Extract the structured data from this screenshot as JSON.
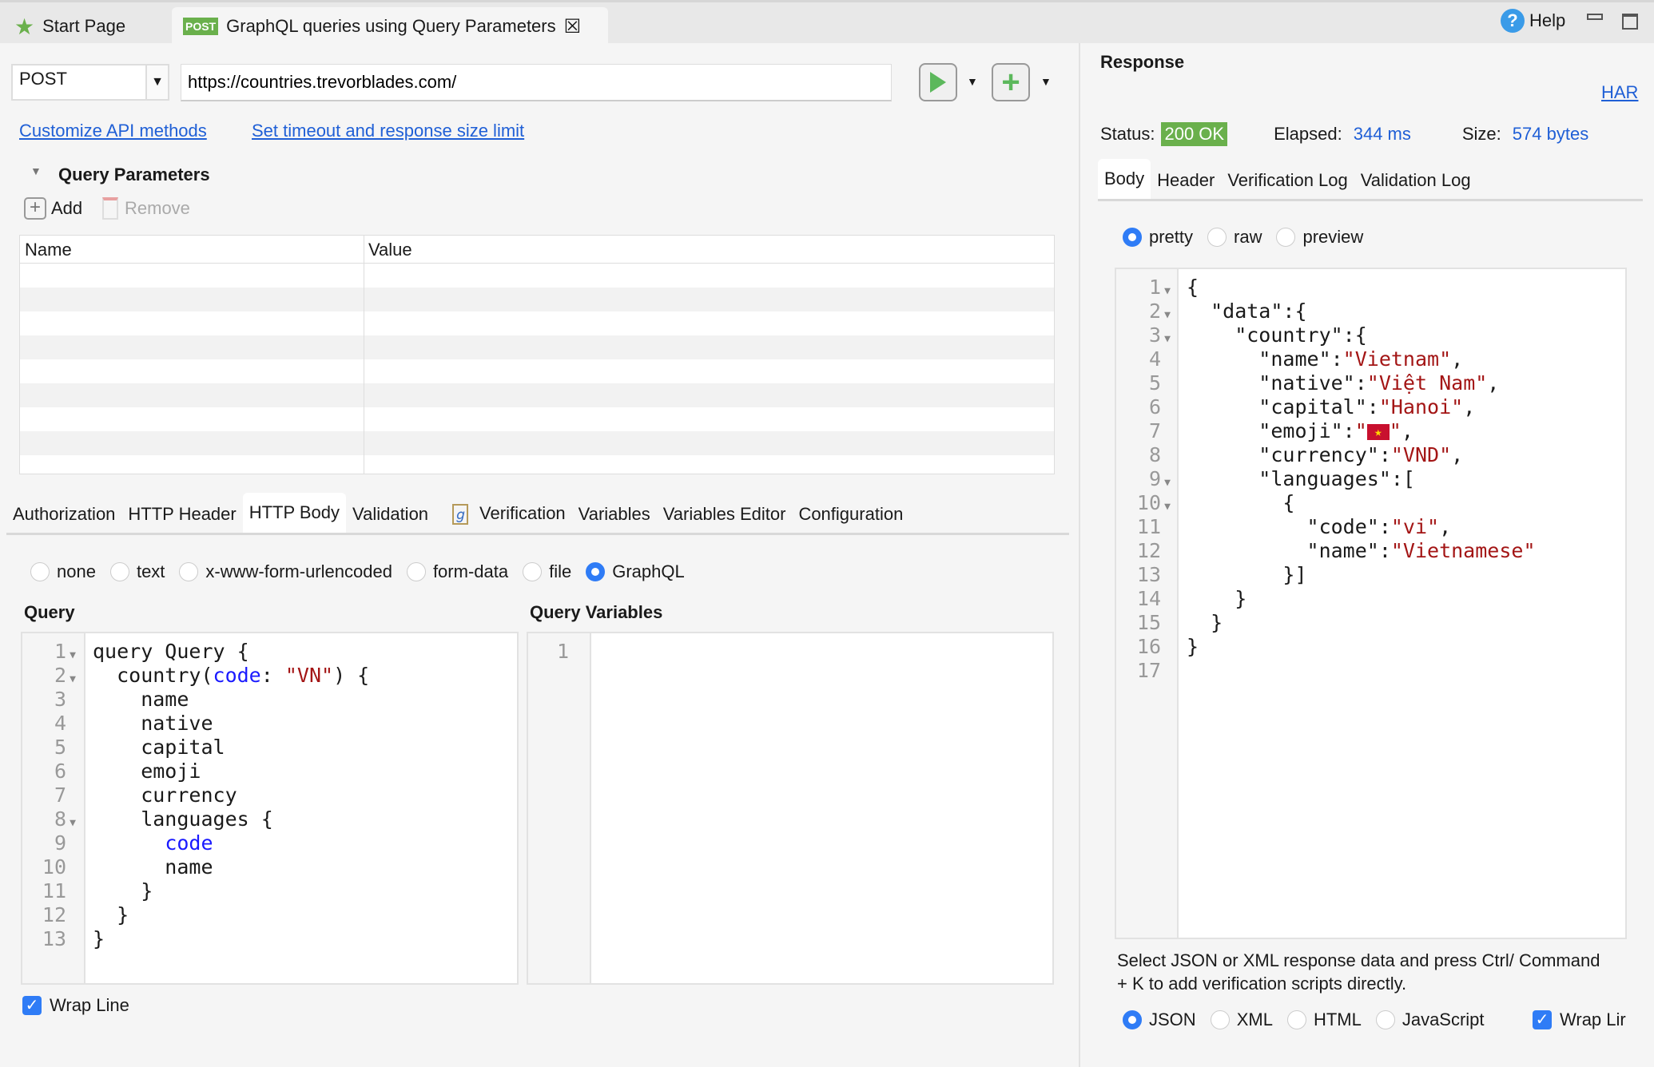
{
  "tabs": [
    {
      "label": "Start Page",
      "icon": "star-icon"
    },
    {
      "badge": "POST",
      "label": "GraphQL queries using Query Parameters",
      "icon": "close-icon"
    }
  ],
  "window": {
    "help": "Help"
  },
  "request": {
    "method": "POST",
    "url": "https://countries.trevorblades.com/",
    "links": {
      "customize": "Customize API methods",
      "timeout": "Set timeout and response size limit"
    }
  },
  "query_params": {
    "title": "Query Parameters",
    "add": "Add",
    "remove": "Remove",
    "columns": [
      "Name",
      "Value"
    ],
    "rows": []
  },
  "req_tabs": [
    "Authorization",
    "HTTP Header",
    "HTTP Body",
    "Validation",
    "Verification",
    "Variables",
    "Variables Editor",
    "Configuration"
  ],
  "req_active_tab": "HTTP Body",
  "body_types": [
    "none",
    "text",
    "x-www-form-urlencoded",
    "form-data",
    "file",
    "GraphQL"
  ],
  "body_selected": "GraphQL",
  "query": {
    "label": "Query",
    "fold_lines": [
      1,
      2,
      8
    ],
    "lines": [
      [
        [
          "query Query {",
          ""
        ]
      ],
      [
        [
          "  country(",
          ""
        ],
        [
          "code",
          "kw"
        ],
        [
          ": ",
          ""
        ],
        [
          "\"VN\"",
          "str"
        ],
        [
          ") {",
          ""
        ]
      ],
      [
        [
          "    name",
          ""
        ]
      ],
      [
        [
          "    native",
          ""
        ]
      ],
      [
        [
          "    capital",
          ""
        ]
      ],
      [
        [
          "    emoji",
          ""
        ]
      ],
      [
        [
          "    currency",
          ""
        ]
      ],
      [
        [
          "    languages {",
          ""
        ]
      ],
      [
        [
          "      ",
          ""
        ],
        [
          "code",
          "kw"
        ]
      ],
      [
        [
          "      name",
          ""
        ]
      ],
      [
        [
          "    }",
          ""
        ]
      ],
      [
        [
          "  }",
          ""
        ]
      ],
      [
        [
          "}",
          ""
        ]
      ]
    ]
  },
  "variables": {
    "label": "Query Variables",
    "lines": [
      [
        [
          "",
          ""
        ]
      ]
    ]
  },
  "wrap_line": {
    "label": "Wrap Line",
    "checked": true
  },
  "response": {
    "title": "Response",
    "har": "HAR",
    "status_label": "Status:",
    "status": "200 OK",
    "status_color": "#6ab04c",
    "elapsed_label": "Elapsed:",
    "elapsed": "344 ms",
    "size_label": "Size:",
    "size": "574 bytes",
    "tabs": [
      "Body",
      "Header",
      "Verification Log",
      "Validation Log"
    ],
    "active_tab": "Body",
    "formats": [
      "pretty",
      "raw",
      "preview"
    ],
    "format_selected": "pretty",
    "fold_lines": [
      1,
      2,
      3,
      9,
      10
    ],
    "lines": [
      [
        [
          "{",
          ""
        ]
      ],
      [
        [
          "  \"data\":{",
          ""
        ]
      ],
      [
        [
          "    \"country\":{",
          ""
        ]
      ],
      [
        [
          "      \"name\":",
          ""
        ],
        [
          "\"Vietnam\"",
          "str"
        ],
        [
          ",",
          ""
        ]
      ],
      [
        [
          "      \"native\":",
          ""
        ],
        [
          "\"Việt Nam\"",
          "str"
        ],
        [
          ",",
          ""
        ]
      ],
      [
        [
          "      \"capital\":",
          ""
        ],
        [
          "\"Hanoi\"",
          "str"
        ],
        [
          ",",
          ""
        ]
      ],
      [
        [
          "      \"emoji\":",
          ""
        ],
        [
          "\"",
          "str"
        ],
        [
          "🇻🇳",
          "flag"
        ],
        [
          "\"",
          "str"
        ],
        [
          ",",
          ""
        ]
      ],
      [
        [
          "      \"currency\":",
          ""
        ],
        [
          "\"VND\"",
          "str"
        ],
        [
          ",",
          ""
        ]
      ],
      [
        [
          "      \"languages\":[",
          ""
        ]
      ],
      [
        [
          "        {",
          ""
        ]
      ],
      [
        [
          "          \"code\":",
          ""
        ],
        [
          "\"vi\"",
          "str"
        ],
        [
          ",",
          ""
        ]
      ],
      [
        [
          "          \"name\":",
          ""
        ],
        [
          "\"Vietnamese\"",
          "str"
        ]
      ],
      [
        [
          "        }]",
          ""
        ]
      ],
      [
        [
          "    }",
          ""
        ]
      ],
      [
        [
          "  }",
          ""
        ]
      ],
      [
        [
          "}",
          ""
        ]
      ],
      [
        [
          "",
          ""
        ]
      ]
    ],
    "hint": "Select JSON or XML response data and press Ctrl/ Command + K to add verification scripts directly.",
    "types": [
      "JSON",
      "XML",
      "HTML",
      "JavaScript"
    ],
    "type_selected": "JSON",
    "wrap": "Wrap Lir",
    "wrap_checked": true
  },
  "colors": {
    "accent": "#2f7cf6",
    "link": "#1f5fd6",
    "string": "#a31515",
    "keyword": "#1a1aff"
  }
}
